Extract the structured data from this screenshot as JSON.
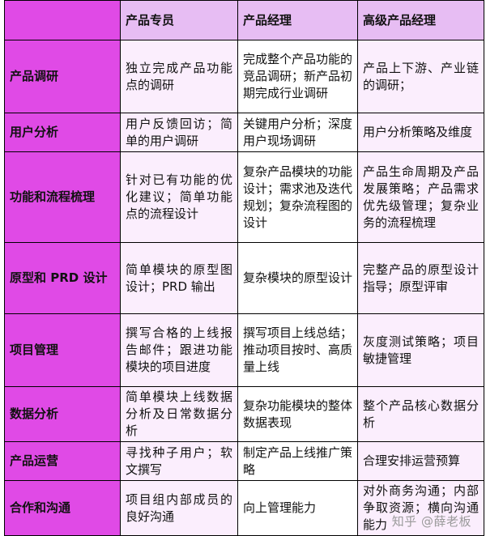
{
  "table": {
    "headers": [
      "",
      "产品专员",
      "产品经理",
      "高级产品经理"
    ],
    "rows": [
      {
        "label": "产品调研",
        "cells": [
          "独立完成产品功能点的调研",
          "完成整个产品功能的竞品调研；新产品初期完成行业调研",
          "产品上下游、产业链的调研；"
        ]
      },
      {
        "label": "用户分析",
        "cells": [
          "用户反馈回访；简单的用户调研",
          "关键用户分析；深度用户现场调研",
          "用户分析策略及维度"
        ]
      },
      {
        "label": "功能和流程梳理",
        "cells": [
          "针对已有功能的优化建议；简单功能点的流程设计",
          "复杂产品模块的功能设计；需求池及迭代规划；复杂流程图的设计",
          "产品生命周期及产品发展策略；产品需求优先级管理；复杂业务的流程梳理"
        ]
      },
      {
        "label": "原型和 PRD 设计",
        "cells": [
          "简单模块的原型图设计；PRD 输出",
          "复杂模块的原型设计",
          "完整产品的原型设计指导；原型评审"
        ]
      },
      {
        "label": "项目管理",
        "cells": [
          "撰写合格的上线报告邮件；跟进功能模块的项目进度",
          "撰写项目上线总结；推动项目按时、高质量上线",
          "灰度测试策略；项目敏捷管理"
        ]
      },
      {
        "label": "数据分析",
        "cells": [
          "简单模块上线数据分析及日常数据分析",
          "复杂功能模块的整体数据表现",
          "整个产品核心数据分析"
        ]
      },
      {
        "label": "产品运营",
        "cells": [
          "寻找种子用户；软文撰写",
          "制定产品上线推广策略",
          "合理安排运营预算"
        ]
      },
      {
        "label": "合作和沟通",
        "cells": [
          "项目组内部成员的良好沟通",
          "向上管理能力",
          "对外商务沟通；内部争取资源；横向沟通能力"
        ]
      }
    ]
  },
  "watermark": "知乎 @薛老板"
}
